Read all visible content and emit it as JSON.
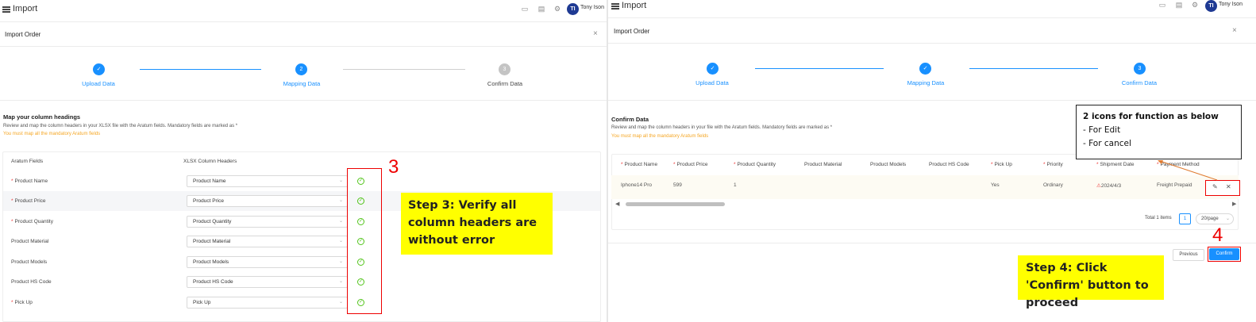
{
  "left": {
    "app_title": "Import",
    "user_name": "Tony Ison",
    "avatar_initials": "TI",
    "modal_title": "Import Order",
    "close_glyph": "×",
    "steps": [
      {
        "label": "Upload Data",
        "marker": "✓",
        "state": "done"
      },
      {
        "label": "Mapping Data",
        "marker": "2",
        "state": "current"
      },
      {
        "label": "Confirm Data",
        "marker": "3",
        "state": "pending"
      }
    ],
    "section_title": "Map your column headings",
    "section_desc": "Review and map the column headers in your XLSX file with the Aratum fields. Mandatory fields are marked as *",
    "section_warning": "You must map all the mandatory Aratum fields",
    "col_aratum": "Aratum Fields",
    "col_xlsx": "XLSX Column Headers",
    "rows": [
      {
        "field": "Product Name",
        "required": true,
        "mapped": "Product Name"
      },
      {
        "field": "Product Price",
        "required": true,
        "mapped": "Product Price"
      },
      {
        "field": "Product Quantity",
        "required": true,
        "mapped": "Product Quantity"
      },
      {
        "field": "Product Material",
        "required": false,
        "mapped": "Product Material"
      },
      {
        "field": "Product Models",
        "required": false,
        "mapped": "Product Models"
      },
      {
        "field": "Product HS Code",
        "required": false,
        "mapped": "Product HS Code"
      },
      {
        "field": "Pick Up",
        "required": true,
        "mapped": "Pick Up"
      }
    ],
    "annotation_number": "3",
    "annotation_text": "Step 3: Verify all column headers are without error"
  },
  "right": {
    "app_title": "Import",
    "user_name": "Tony Ison",
    "avatar_initials": "TI",
    "modal_title": "Import Order",
    "close_glyph": "×",
    "steps": [
      {
        "label": "Upload Data",
        "marker": "✓",
        "state": "done"
      },
      {
        "label": "Mapping Data",
        "marker": "✓",
        "state": "done"
      },
      {
        "label": "Confirm Data",
        "marker": "3",
        "state": "current"
      }
    ],
    "section_title": "Confirm Data",
    "section_desc": "Review and map the column headers in your file with the Aratum fields. Mandatory fields are marked as *",
    "section_warning": "You must map all the mandatory Aratum fields",
    "table_headers": [
      {
        "label": "Product Name",
        "required": true
      },
      {
        "label": "Product Price",
        "required": true
      },
      {
        "label": "Product Quantity",
        "required": true
      },
      {
        "label": "Product Material",
        "required": false
      },
      {
        "label": "Product Models",
        "required": false
      },
      {
        "label": "Product HS Code",
        "required": false
      },
      {
        "label": "Pick Up",
        "required": true
      },
      {
        "label": "Priority",
        "required": true
      },
      {
        "label": "Shipment Date",
        "required": true
      },
      {
        "label": "Payment Method",
        "required": true
      }
    ],
    "table_row": {
      "product_name": "Iphone14 Pro",
      "product_price": "599",
      "product_quantity": "1",
      "product_material": "",
      "product_models": "",
      "product_hs_code": "",
      "pick_up": "Yes",
      "priority": "Ordinary",
      "shipment_date": "2024/4/3",
      "payment_method": "Freight Prepaid"
    },
    "edit_icon_glyph": "✎",
    "cancel_icon_glyph": "✕",
    "total_text": "Total 1 items",
    "current_page": "1",
    "page_size": "20/page",
    "previous_button": "Previous",
    "confirm_button": "Confirm",
    "tooltip_title": "2 icons for function as below",
    "tooltip_lines": [
      "- For Edit",
      "- For cancel"
    ],
    "annotation_number": "4",
    "annotation_text": "Step 4: Click 'Confirm' button to proceed"
  },
  "colors": {
    "primary": "#1890ff",
    "warning": "#f5a623",
    "success": "#52c41a",
    "annotation_red": "#e00000",
    "note_yellow": "#ffff00",
    "required_star": "#e33333"
  }
}
